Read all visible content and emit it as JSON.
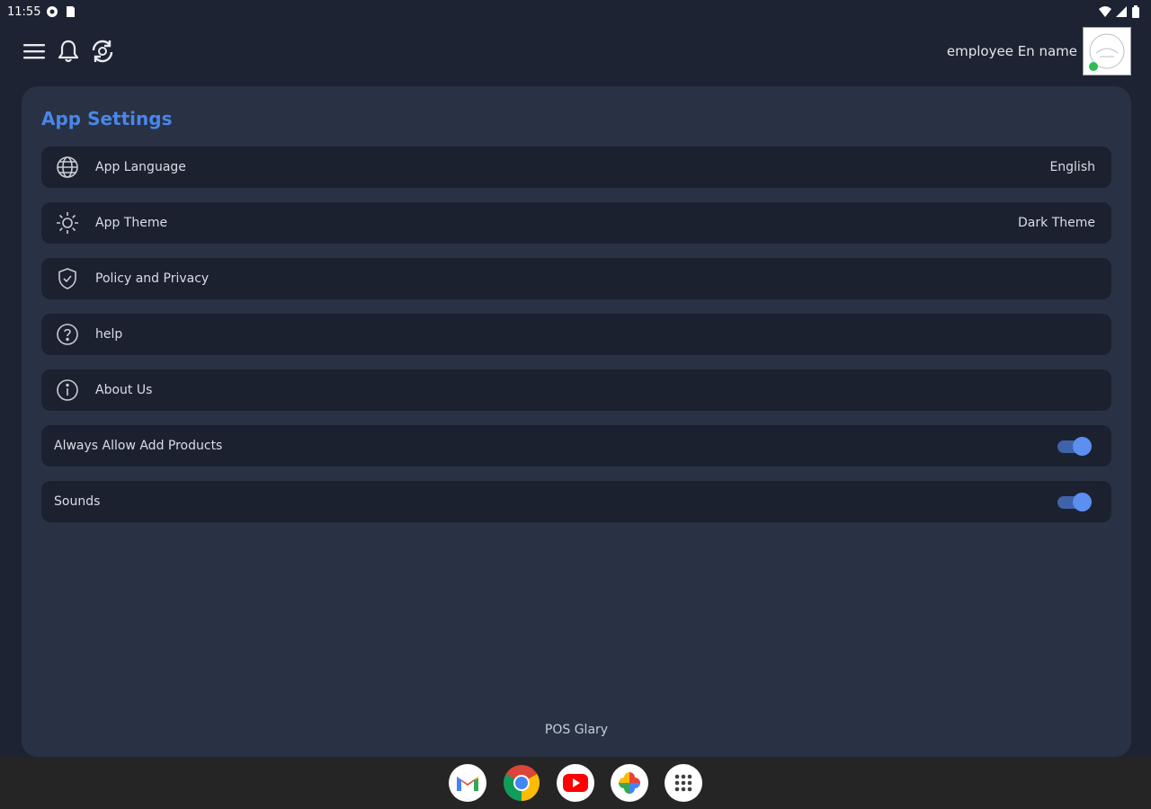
{
  "status_bar": {
    "time": "11:55"
  },
  "header": {
    "employee_name": "employee En name"
  },
  "settings": {
    "title": "App Settings",
    "items": [
      {
        "label": "App Language",
        "value": "English",
        "icon": "globe-icon"
      },
      {
        "label": "App Theme",
        "value": "Dark Theme",
        "icon": "sun-icon"
      },
      {
        "label": "Policy and Privacy",
        "value": "",
        "icon": "shield-check-icon"
      },
      {
        "label": "help",
        "value": "",
        "icon": "help-circle-icon"
      },
      {
        "label": "About Us",
        "value": "",
        "icon": "info-circle-icon"
      }
    ],
    "toggles": [
      {
        "label": "Always Allow Add Products",
        "on": true
      },
      {
        "label": "Sounds",
        "on": true
      }
    ]
  },
  "footer": {
    "app_name": "POS Glary"
  },
  "taskbar": {
    "apps": [
      "gmail-icon",
      "chrome-icon",
      "youtube-icon",
      "photos-icon",
      "app-drawer-icon"
    ]
  },
  "colors": {
    "background": "#1d2332",
    "card": "#283244",
    "row": "#1c2130",
    "accent": "#4a86e8",
    "toggle_on": "#5b8ff0"
  }
}
